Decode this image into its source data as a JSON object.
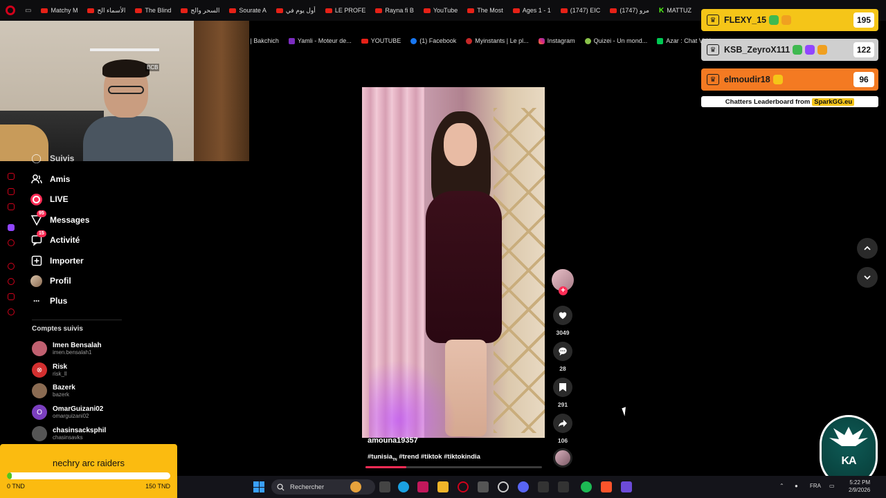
{
  "browser": {
    "bookmarks_row1": [
      "Matchy M",
      "الأسماء الح",
      "The Blind",
      "السحر والج",
      "Sourate A",
      "أول يوم في",
      "LE PROFE",
      "Rayna fi B",
      "YouTube",
      "The Most",
      "Ages 1 - 1",
      "(1747) EIC",
      "مرو (1747)",
      "MATTUZ"
    ],
    "bookmarks_row2": [
      "il | Bakchich",
      "Yamli - Moteur de...",
      "YOUTUBE",
      "(1) Facebook",
      "Myinstants | Le pl...",
      "Instagram",
      "Quizei - Un mond...",
      "Azar : Chat Vidéo..."
    ]
  },
  "webcam": {
    "overlay_label": "BCB"
  },
  "tiktok_nav": {
    "partial_top": "Suivis",
    "items": [
      {
        "label": "Amis",
        "icon": "friends-icon"
      },
      {
        "label": "LIVE",
        "icon": "live-icon"
      },
      {
        "label": "Messages",
        "icon": "messages-icon",
        "badge": "95"
      },
      {
        "label": "Activité",
        "icon": "activity-icon",
        "badge": "15"
      },
      {
        "label": "Importer",
        "icon": "upload-icon"
      },
      {
        "label": "Profil",
        "icon": "profile-icon"
      },
      {
        "label": "Plus",
        "icon": "more-icon"
      }
    ]
  },
  "followed": {
    "title": "Comptes suivis",
    "accounts": [
      {
        "name": "Imen Bensalah",
        "handle": "imen.bensalah1",
        "color": "#c06070"
      },
      {
        "name": "Risk",
        "handle": "risk_ll",
        "color": "#d32f2f"
      },
      {
        "name": "Bazerk",
        "handle": "bazerk",
        "color": "#8a6b52"
      },
      {
        "name": "OmarGuizani02",
        "handle": "omarguizani02",
        "color": "#7b3fbf",
        "initial": "O"
      },
      {
        "name": "chasinsacksphil",
        "handle": "chasinsavks",
        "color": "#555"
      }
    ]
  },
  "goal": {
    "title": "nechry arc raiders",
    "min": "0 TND",
    "max": "150 TND",
    "progress": 0.03
  },
  "video": {
    "author": "amouna19357",
    "tags": "#tunisia",
    "tags_sub": "TN",
    "tags_rest": " #trend #tiktok #tiktokindia",
    "progress": 0.23
  },
  "actions": {
    "likes": "3049",
    "comments": "28",
    "saves": "291",
    "shares": "106"
  },
  "leaderboard": {
    "rows": [
      {
        "name": "FLEXY_15",
        "score": "195",
        "bg": "#f5c518",
        "fg": "#1a1a1a"
      },
      {
        "name": "KSB_ZeyroX111",
        "score": "122",
        "bg": "#cfcfcf",
        "fg": "#1a1a1a"
      },
      {
        "name": "elmoudir18",
        "score": "96",
        "bg": "#f47a22",
        "fg": "#1a1a1a"
      }
    ],
    "footer": "Chatters Leaderboard from",
    "brand": "SparkGG.eu"
  },
  "logo": {
    "text": "KA"
  },
  "taskbar": {
    "search": "Rechercher",
    "lang": "FRA",
    "time": "5:22 PM",
    "date": "2/9/2026"
  }
}
